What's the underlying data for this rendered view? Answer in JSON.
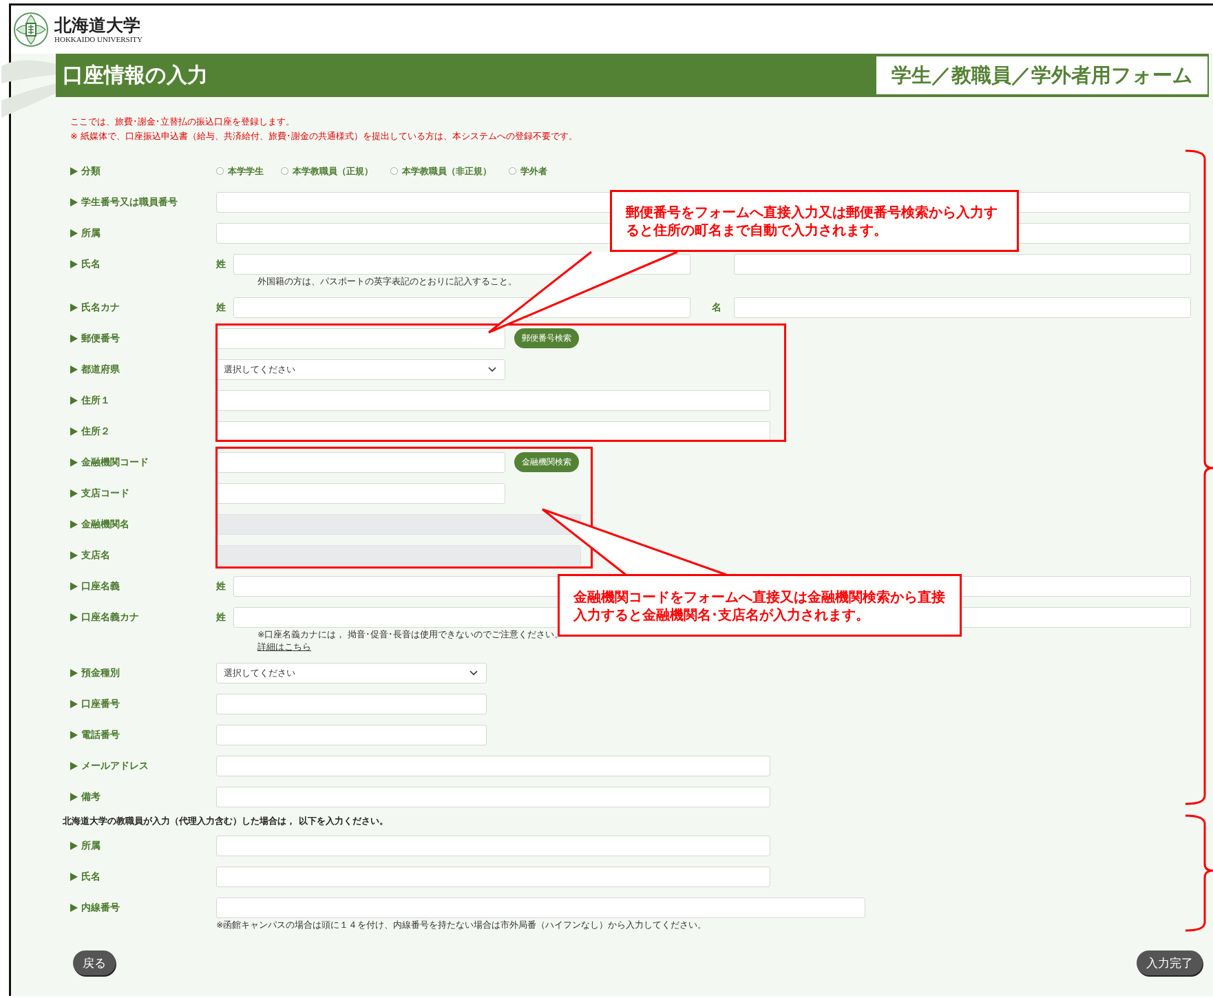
{
  "header": {
    "university_name": "北海道大学",
    "university_name_en": "HOKKAIDO UNIVERSITY"
  },
  "title_bar": {
    "title": "口座情報の入力",
    "form_type": "学生／教職員／学外者用フォーム"
  },
  "notices": [
    "ここでは、旅費･謝金･立替払の振込口座を登録します。",
    "※ 紙媒体で、口座振込申込書（給与、共済給付、旅費･謝金の共通様式）を提出している方は、本システムへの登録不要です。"
  ],
  "fields": [
    {
      "kind": "radio",
      "label": "分類",
      "options": [
        {
          "label": "本学学生",
          "selected": false
        },
        {
          "label": "本学教職員（正規）",
          "selected": false
        },
        {
          "label": "本学教職員（非正規）",
          "selected": false
        },
        {
          "label": "学外者",
          "selected": false
        }
      ]
    },
    {
      "kind": "text",
      "label": "学生番号又は職員番号",
      "disabled": false
    },
    {
      "kind": "text",
      "label": "所属",
      "disabled": false
    },
    {
      "kind": "name",
      "label": "氏名",
      "family_label": "姓",
      "disabled": false,
      "note": "外国籍の方は、パスポートの英字表記のとおりに記入すること。"
    },
    {
      "kind": "name",
      "label": "氏名カナ",
      "family_label": "姓",
      "given_label": "名",
      "disabled": false
    },
    {
      "kind": "text",
      "label": "郵便番号",
      "disabled": false,
      "button": "郵便番号検索"
    },
    {
      "kind": "select",
      "label": "都道府県",
      "disabled": false,
      "value": "選択してください"
    },
    {
      "kind": "text",
      "label": "住所１",
      "disabled": false
    },
    {
      "kind": "text",
      "label": "住所２",
      "disabled": false
    },
    {
      "kind": "text",
      "label": "金融機関コード",
      "disabled": false,
      "button": "金融機関検索"
    },
    {
      "kind": "text",
      "label": "支店コード",
      "disabled": false
    },
    {
      "kind": "text",
      "label": "金融機関名",
      "disabled": true
    },
    {
      "kind": "text",
      "label": "支店名",
      "disabled": true
    },
    {
      "kind": "name",
      "label": "口座名義",
      "family_label": "姓",
      "disabled": false
    },
    {
      "kind": "name",
      "label": "口座名義カナ",
      "family_label": "姓",
      "disabled": false,
      "note": "※口座名義カナには， 拗音･促音･長音は使用できないのでご注意ください。",
      "link": "詳細はこちら"
    },
    {
      "kind": "select",
      "label": "預金種別",
      "disabled": false,
      "value": "選択してください"
    },
    {
      "kind": "text",
      "label": "口座番号",
      "disabled": false
    },
    {
      "kind": "text",
      "label": "電話番号",
      "disabled": false
    },
    {
      "kind": "text",
      "label": "メールアドレス",
      "disabled": false
    },
    {
      "kind": "text",
      "label": "備考",
      "disabled": false
    }
  ],
  "staff_section": {
    "heading": "北海道大学の教職員が入力（代理入力含む）した場合は， 以下を入力ください。",
    "fields": [
      {
        "kind": "text",
        "label": "所属",
        "disabled": false
      },
      {
        "kind": "text",
        "label": "氏名",
        "disabled": false
      },
      {
        "kind": "text",
        "label": "内線番号",
        "disabled": false,
        "note": "※函館キャンパスの場合は頭に１４を付け、内線番号を持たない場合は市外局番（ハイフンなし）から入力してください。"
      }
    ]
  },
  "back_button": "戻る",
  "submit_button": "入力完了",
  "callouts": [
    {
      "text": "郵便番号をフォームへ直接入力又は郵便番号検索から入力すると住所の町名まで自動で入力されます。"
    },
    {
      "text": "金融機関コードをフォームへ直接又は金融機関検索から直接入力すると金融機関名･支店名が入力されます。"
    }
  ]
}
